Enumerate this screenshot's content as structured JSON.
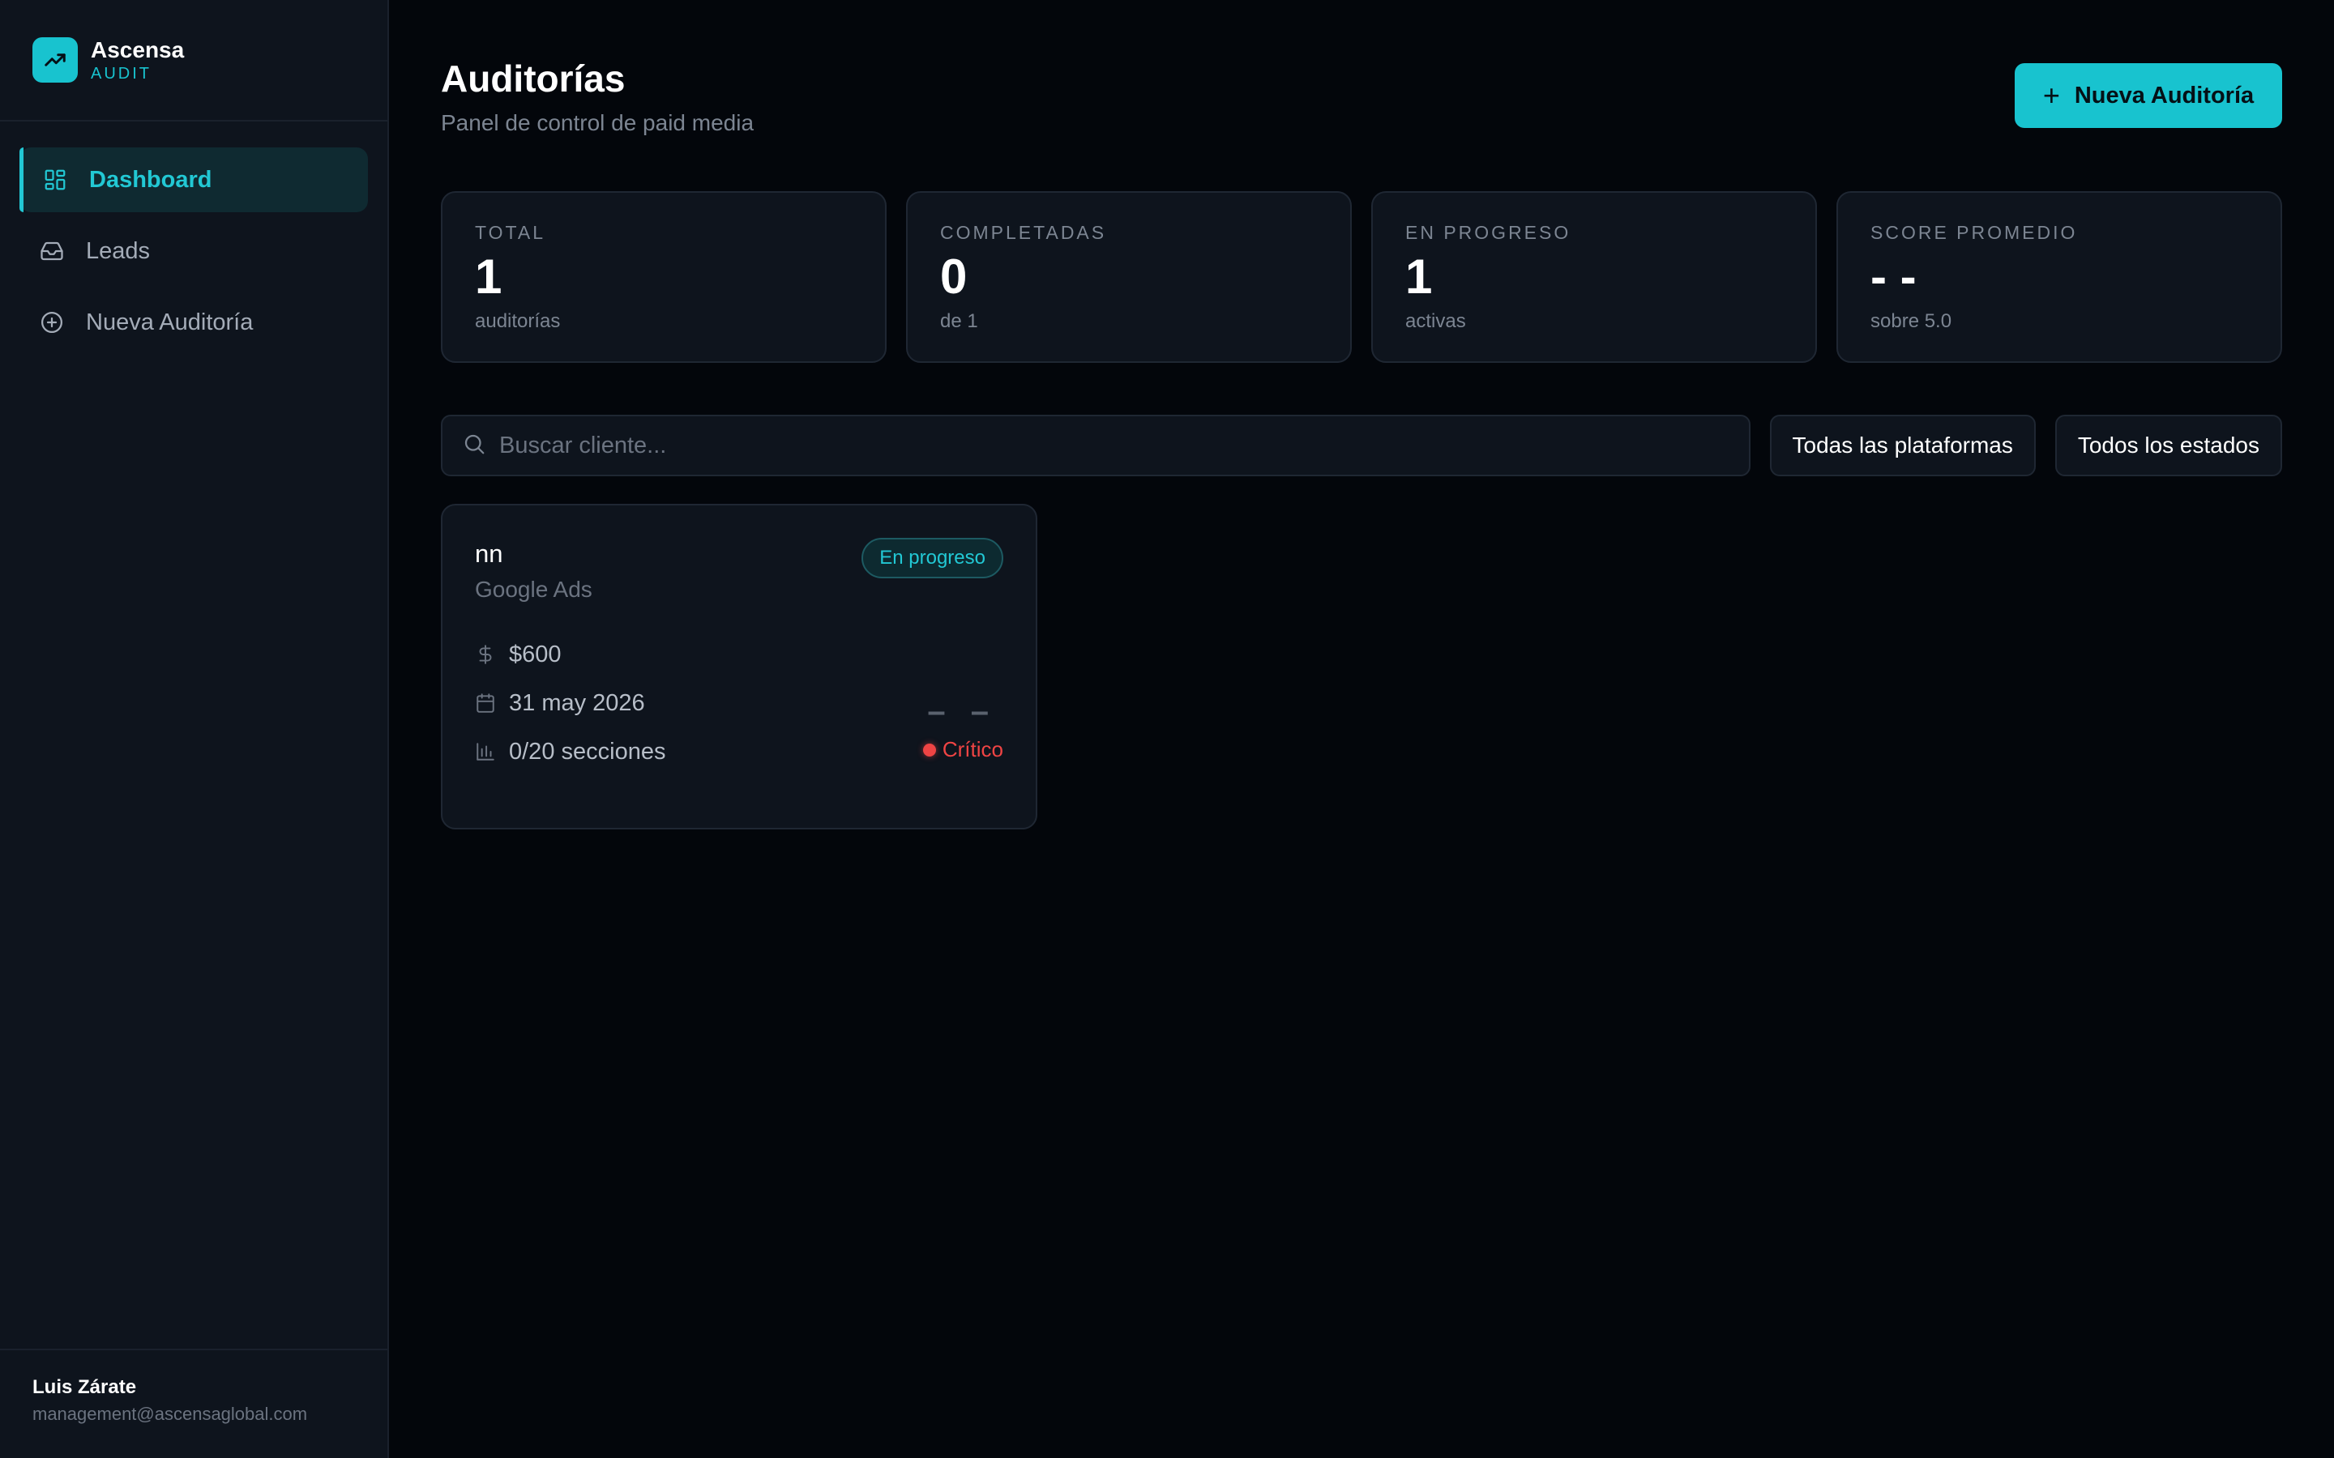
{
  "brand": {
    "name": "Ascensa",
    "sub": "AUDIT",
    "logo_icon": "trending-up-icon",
    "accent": "#18c3cf"
  },
  "sidebar": {
    "items": [
      {
        "label": "Dashboard",
        "icon": "dashboard-grid-icon",
        "active": true
      },
      {
        "label": "Leads",
        "icon": "inbox-icon",
        "active": false
      },
      {
        "label": "Nueva Auditoría",
        "icon": "plus-circle-icon",
        "active": false
      }
    ]
  },
  "user": {
    "name": "Luis Zárate",
    "email": "management@ascensaglobal.com"
  },
  "header": {
    "title": "Auditorías",
    "subtitle": "Panel de control de paid media",
    "new_button_label": "Nueva Auditoría"
  },
  "stats": [
    {
      "label": "TOTAL",
      "value": "1",
      "sub": "auditorías"
    },
    {
      "label": "COMPLETADAS",
      "value": "0",
      "sub": "de 1"
    },
    {
      "label": "EN PROGRESO",
      "value": "1",
      "sub": "activas"
    },
    {
      "label": "SCORE PROMEDIO",
      "value": "- -",
      "sub": "sobre 5.0"
    }
  ],
  "filters": {
    "search_placeholder": "Buscar cliente...",
    "platform_label": "Todas las plataformas",
    "status_label": "Todos los estados"
  },
  "audits": [
    {
      "name": "nn",
      "platform": "Google Ads",
      "status": "En progreso",
      "budget": "$600",
      "date": "31 may 2026",
      "sections": "0/20 secciones",
      "score": "– –",
      "risk": "Crítico",
      "risk_color": "#ef4444"
    }
  ]
}
